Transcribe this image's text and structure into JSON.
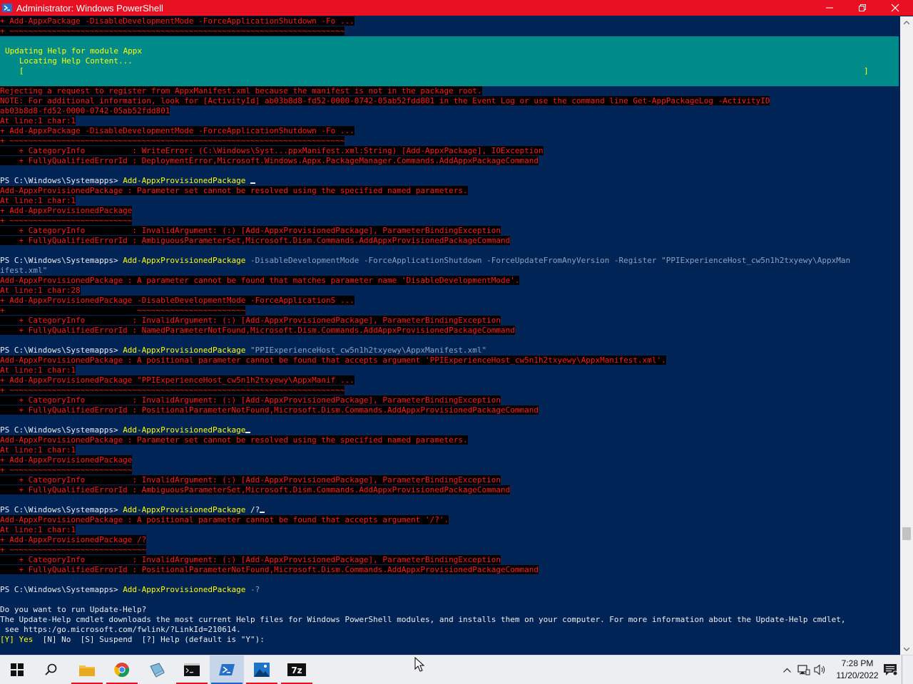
{
  "window": {
    "title": "Administrator: Windows PowerShell"
  },
  "progress": {
    "title": "Updating Help for module Appx",
    "status": "   Locating Help Content...",
    "bar_left": "   [",
    "bar_right": "]"
  },
  "console_lines": [
    {
      "segs": [
        {
          "t": "+ Add-AppxPackage -DisableDevelopmentMode -ForceApplicationShutdown -Fo ...",
          "c": "fg-red bg-blk"
        }
      ]
    },
    {
      "segs": [
        {
          "t": "+ ~~~~~~~~~~~~~~~~~~~~~~~~~~~~~~~~~~~~~~~~~~~~~~~~~~~~~~~~~~~~~~~~~~~~~~~",
          "c": "fg-red bg-blk"
        }
      ]
    },
    {
      "segs": []
    },
    {
      "segs": []
    },
    {
      "segs": []
    },
    {
      "segs": []
    },
    {
      "segs": []
    },
    {
      "segs": [
        {
          "t": "Rejecting a request to register from AppxManifest.xml because the manifest is not in the package root.",
          "c": "fg-red bg-blk"
        }
      ]
    },
    {
      "segs": [
        {
          "t": "NOTE: For additional information, look for [ActivityId] ab03b8d8-fd52-0000-0742-05ab52fdd801 in the Event Log or use the command line Get-AppPackageLog -ActivityID",
          "c": "fg-red bg-blk"
        }
      ]
    },
    {
      "segs": [
        {
          "t": "ab03b8d8-fd52-0000-0742-05ab52fdd801",
          "c": "fg-red bg-blk"
        }
      ]
    },
    {
      "segs": [
        {
          "t": "At line:1 char:1",
          "c": "fg-red bg-blk"
        }
      ]
    },
    {
      "segs": [
        {
          "t": "+ Add-AppxPackage -DisableDevelopmentMode -ForceApplicationShutdown -Fo ...",
          "c": "fg-red bg-blk"
        }
      ]
    },
    {
      "segs": [
        {
          "t": "+ ~~~~~~~~~~~~~~~~~~~~~~~~~~~~~~~~~~~~~~~~~~~~~~~~~~~~~~~~~~~~~~~~~~~~~~~",
          "c": "fg-red bg-blk"
        }
      ]
    },
    {
      "segs": [
        {
          "t": "    + CategoryInfo          : WriteError: (C:\\Windows\\Syst...ppxManifest.xml:String) [Add-AppxPackage], IOException",
          "c": "fg-red bg-blk"
        }
      ]
    },
    {
      "segs": [
        {
          "t": "    + FullyQualifiedErrorId : DeploymentError,Microsoft.Windows.Appx.PackageManager.Commands.AddAppxPackageCommand",
          "c": "fg-red bg-blk"
        }
      ]
    },
    {
      "segs": []
    },
    {
      "segs": [
        {
          "t": "PS C:\\Windows\\Systemapps> ",
          "c": "fg-white"
        },
        {
          "t": "Add-AppxProvisionedPackage",
          "c": "fg-yel"
        },
        {
          "t": " ",
          "c": "fg-white"
        },
        {
          "cursor": true
        }
      ]
    },
    {
      "segs": [
        {
          "t": "Add-AppxProvisionedPackage : Parameter set cannot be resolved using the specified named parameters.",
          "c": "fg-red bg-blk"
        }
      ]
    },
    {
      "segs": [
        {
          "t": "At line:1 char:1",
          "c": "fg-red bg-blk"
        }
      ]
    },
    {
      "segs": [
        {
          "t": "+ Add-AppxProvisionedPackage",
          "c": "fg-red bg-blk"
        }
      ]
    },
    {
      "segs": [
        {
          "t": "+ ~~~~~~~~~~~~~~~~~~~~~~~~~~",
          "c": "fg-red bg-blk"
        }
      ]
    },
    {
      "segs": [
        {
          "t": "    + CategoryInfo          : InvalidArgument: (:) [Add-AppxProvisionedPackage], ParameterBindingException",
          "c": "fg-red bg-blk"
        }
      ]
    },
    {
      "segs": [
        {
          "t": "    + FullyQualifiedErrorId : AmbiguousParameterSet,Microsoft.Dism.Commands.AddAppxProvisionedPackageCommand",
          "c": "fg-red bg-blk"
        }
      ]
    },
    {
      "segs": []
    },
    {
      "segs": [
        {
          "t": "PS C:\\Windows\\Systemapps> ",
          "c": "fg-white"
        },
        {
          "t": "Add-AppxProvisionedPackage",
          "c": "fg-yel"
        },
        {
          "t": " -DisableDevelopmentMode -ForceApplicationShutdown -ForceUpdateFromAnyVersion -Register ",
          "c": "fg-gray"
        },
        {
          "t": "\"PPIExperienceHost_cw5n1h2txyewy\\AppxMan",
          "c": "fg-gray"
        }
      ]
    },
    {
      "segs": [
        {
          "t": "ifest.xml\"",
          "c": "fg-gray"
        }
      ]
    },
    {
      "segs": [
        {
          "t": "Add-AppxProvisionedPackage : A parameter cannot be found that matches parameter name 'DisableDevelopmentMode'.",
          "c": "fg-red bg-blk"
        }
      ]
    },
    {
      "segs": [
        {
          "t": "At line:1 char:28",
          "c": "fg-red bg-blk"
        }
      ]
    },
    {
      "segs": [
        {
          "t": "+ Add-AppxProvisionedPackage -DisableDevelopmentMode -ForceApplicationS ...",
          "c": "fg-red bg-blk"
        }
      ]
    },
    {
      "segs": [
        {
          "t": "+                            ~~~~~~~~~~~~~~~~~~~~~~~",
          "c": "fg-red bg-blk"
        }
      ]
    },
    {
      "segs": [
        {
          "t": "    + CategoryInfo          : InvalidArgument: (:) [Add-AppxProvisionedPackage], ParameterBindingException",
          "c": "fg-red bg-blk"
        }
      ]
    },
    {
      "segs": [
        {
          "t": "    + FullyQualifiedErrorId : NamedParameterNotFound,Microsoft.Dism.Commands.AddAppxProvisionedPackageCommand",
          "c": "fg-red bg-blk"
        }
      ]
    },
    {
      "segs": []
    },
    {
      "segs": [
        {
          "t": "PS C:\\Windows\\Systemapps> ",
          "c": "fg-white"
        },
        {
          "t": "Add-AppxProvisionedPackage",
          "c": "fg-yel"
        },
        {
          "t": " \"PPIExperienceHost_cw5n1h2txyewy\\AppxManifest.xml\"",
          "c": "fg-gray"
        }
      ]
    },
    {
      "segs": [
        {
          "t": "Add-AppxProvisionedPackage : A positional parameter cannot be found that accepts argument 'PPIExperienceHost_cw5n1h2txyewy\\AppxManifest.xml'.",
          "c": "fg-red bg-blk"
        }
      ]
    },
    {
      "segs": [
        {
          "t": "At line:1 char:1",
          "c": "fg-red bg-blk"
        }
      ]
    },
    {
      "segs": [
        {
          "t": "+ Add-AppxProvisionedPackage \"PPIExperienceHost_cw5n1h2txyewy\\AppxManif ...",
          "c": "fg-red bg-blk"
        }
      ]
    },
    {
      "segs": [
        {
          "t": "+ ~~~~~~~~~~~~~~~~~~~~~~~~~~~~~~~~~~~~~~~~~~~~~~~~~~~~~~~~~~~~~~~~~~~~~~~",
          "c": "fg-red bg-blk"
        }
      ]
    },
    {
      "segs": [
        {
          "t": "    + CategoryInfo          : InvalidArgument: (:) [Add-AppxProvisionedPackage], ParameterBindingException",
          "c": "fg-red bg-blk"
        }
      ]
    },
    {
      "segs": [
        {
          "t": "    + FullyQualifiedErrorId : PositionalParameterNotFound,Microsoft.Dism.Commands.AddAppxProvisionedPackageCommand",
          "c": "fg-red bg-blk"
        }
      ]
    },
    {
      "segs": []
    },
    {
      "segs": [
        {
          "t": "PS C:\\Windows\\Systemapps> ",
          "c": "fg-white"
        },
        {
          "t": "Add-AppxProvisionedPackage",
          "c": "fg-yel"
        },
        {
          "cursor": true
        }
      ]
    },
    {
      "segs": [
        {
          "t": "Add-AppxProvisionedPackage : Parameter set cannot be resolved using the specified named parameters.",
          "c": "fg-red bg-blk"
        }
      ]
    },
    {
      "segs": [
        {
          "t": "At line:1 char:1",
          "c": "fg-red bg-blk"
        }
      ]
    },
    {
      "segs": [
        {
          "t": "+ Add-AppxProvisionedPackage",
          "c": "fg-red bg-blk"
        }
      ]
    },
    {
      "segs": [
        {
          "t": "+ ~~~~~~~~~~~~~~~~~~~~~~~~~~",
          "c": "fg-red bg-blk"
        }
      ]
    },
    {
      "segs": [
        {
          "t": "    + CategoryInfo          : InvalidArgument: (:) [Add-AppxProvisionedPackage], ParameterBindingException",
          "c": "fg-red bg-blk"
        }
      ]
    },
    {
      "segs": [
        {
          "t": "    + FullyQualifiedErrorId : AmbiguousParameterSet,Microsoft.Dism.Commands.AddAppxProvisionedPackageCommand",
          "c": "fg-red bg-blk"
        }
      ]
    },
    {
      "segs": []
    },
    {
      "segs": [
        {
          "t": "PS C:\\Windows\\Systemapps> ",
          "c": "fg-white"
        },
        {
          "t": "Add-AppxProvisionedPackage",
          "c": "fg-yel"
        },
        {
          "t": " /?",
          "c": "fg-white"
        },
        {
          "cursor": true
        }
      ]
    },
    {
      "segs": [
        {
          "t": "Add-AppxProvisionedPackage : A positional parameter cannot be found that accepts argument '/?'.",
          "c": "fg-red bg-blk"
        }
      ]
    },
    {
      "segs": [
        {
          "t": "At line:1 char:1",
          "c": "fg-red bg-blk"
        }
      ]
    },
    {
      "segs": [
        {
          "t": "+ Add-AppxProvisionedPackage /?",
          "c": "fg-red bg-blk"
        }
      ]
    },
    {
      "segs": [
        {
          "t": "+ ~~~~~~~~~~~~~~~~~~~~~~~~~~~~~",
          "c": "fg-red bg-blk"
        }
      ]
    },
    {
      "segs": [
        {
          "t": "    + CategoryInfo          : InvalidArgument: (:) [Add-AppxProvisionedPackage], ParameterBindingException",
          "c": "fg-red bg-blk"
        }
      ]
    },
    {
      "segs": [
        {
          "t": "    + FullyQualifiedErrorId : PositionalParameterNotFound,Microsoft.Dism.Commands.AddAppxProvisionedPackageCommand",
          "c": "fg-red bg-blk"
        }
      ]
    },
    {
      "segs": []
    },
    {
      "segs": [
        {
          "t": "PS C:\\Windows\\Systemapps> ",
          "c": "fg-white"
        },
        {
          "t": "Add-AppxProvisionedPackage",
          "c": "fg-yel"
        },
        {
          "t": " -?",
          "c": "fg-gray"
        }
      ]
    },
    {
      "segs": []
    },
    {
      "segs": [
        {
          "t": "Do you want to run Update-Help?",
          "c": "fg-white"
        }
      ]
    },
    {
      "segs": [
        {
          "t": "The Update-Help cmdlet downloads the most current Help files for Windows PowerShell modules, and installs them on your computer. For more information about the Update-Help cmdlet,",
          "c": "fg-white"
        }
      ]
    },
    {
      "segs": [
        {
          "t": " see https:/go.microsoft.com/fwlink/?LinkId=210614.",
          "c": "fg-white"
        }
      ]
    },
    {
      "segs": [
        {
          "t": "[Y] Yes",
          "c": "fg-yel"
        },
        {
          "t": "  [N] No  [S] Suspend  [?] Help (default is \"Y\"):",
          "c": "fg-white"
        }
      ]
    }
  ],
  "taskbar": {
    "apps": [
      "start",
      "search",
      "file-explorer",
      "chrome",
      "notepad",
      "cmd",
      "powershell",
      "photos",
      "7zip"
    ],
    "tray": {
      "time": "7:28 PM",
      "date": "11/20/2022"
    }
  }
}
